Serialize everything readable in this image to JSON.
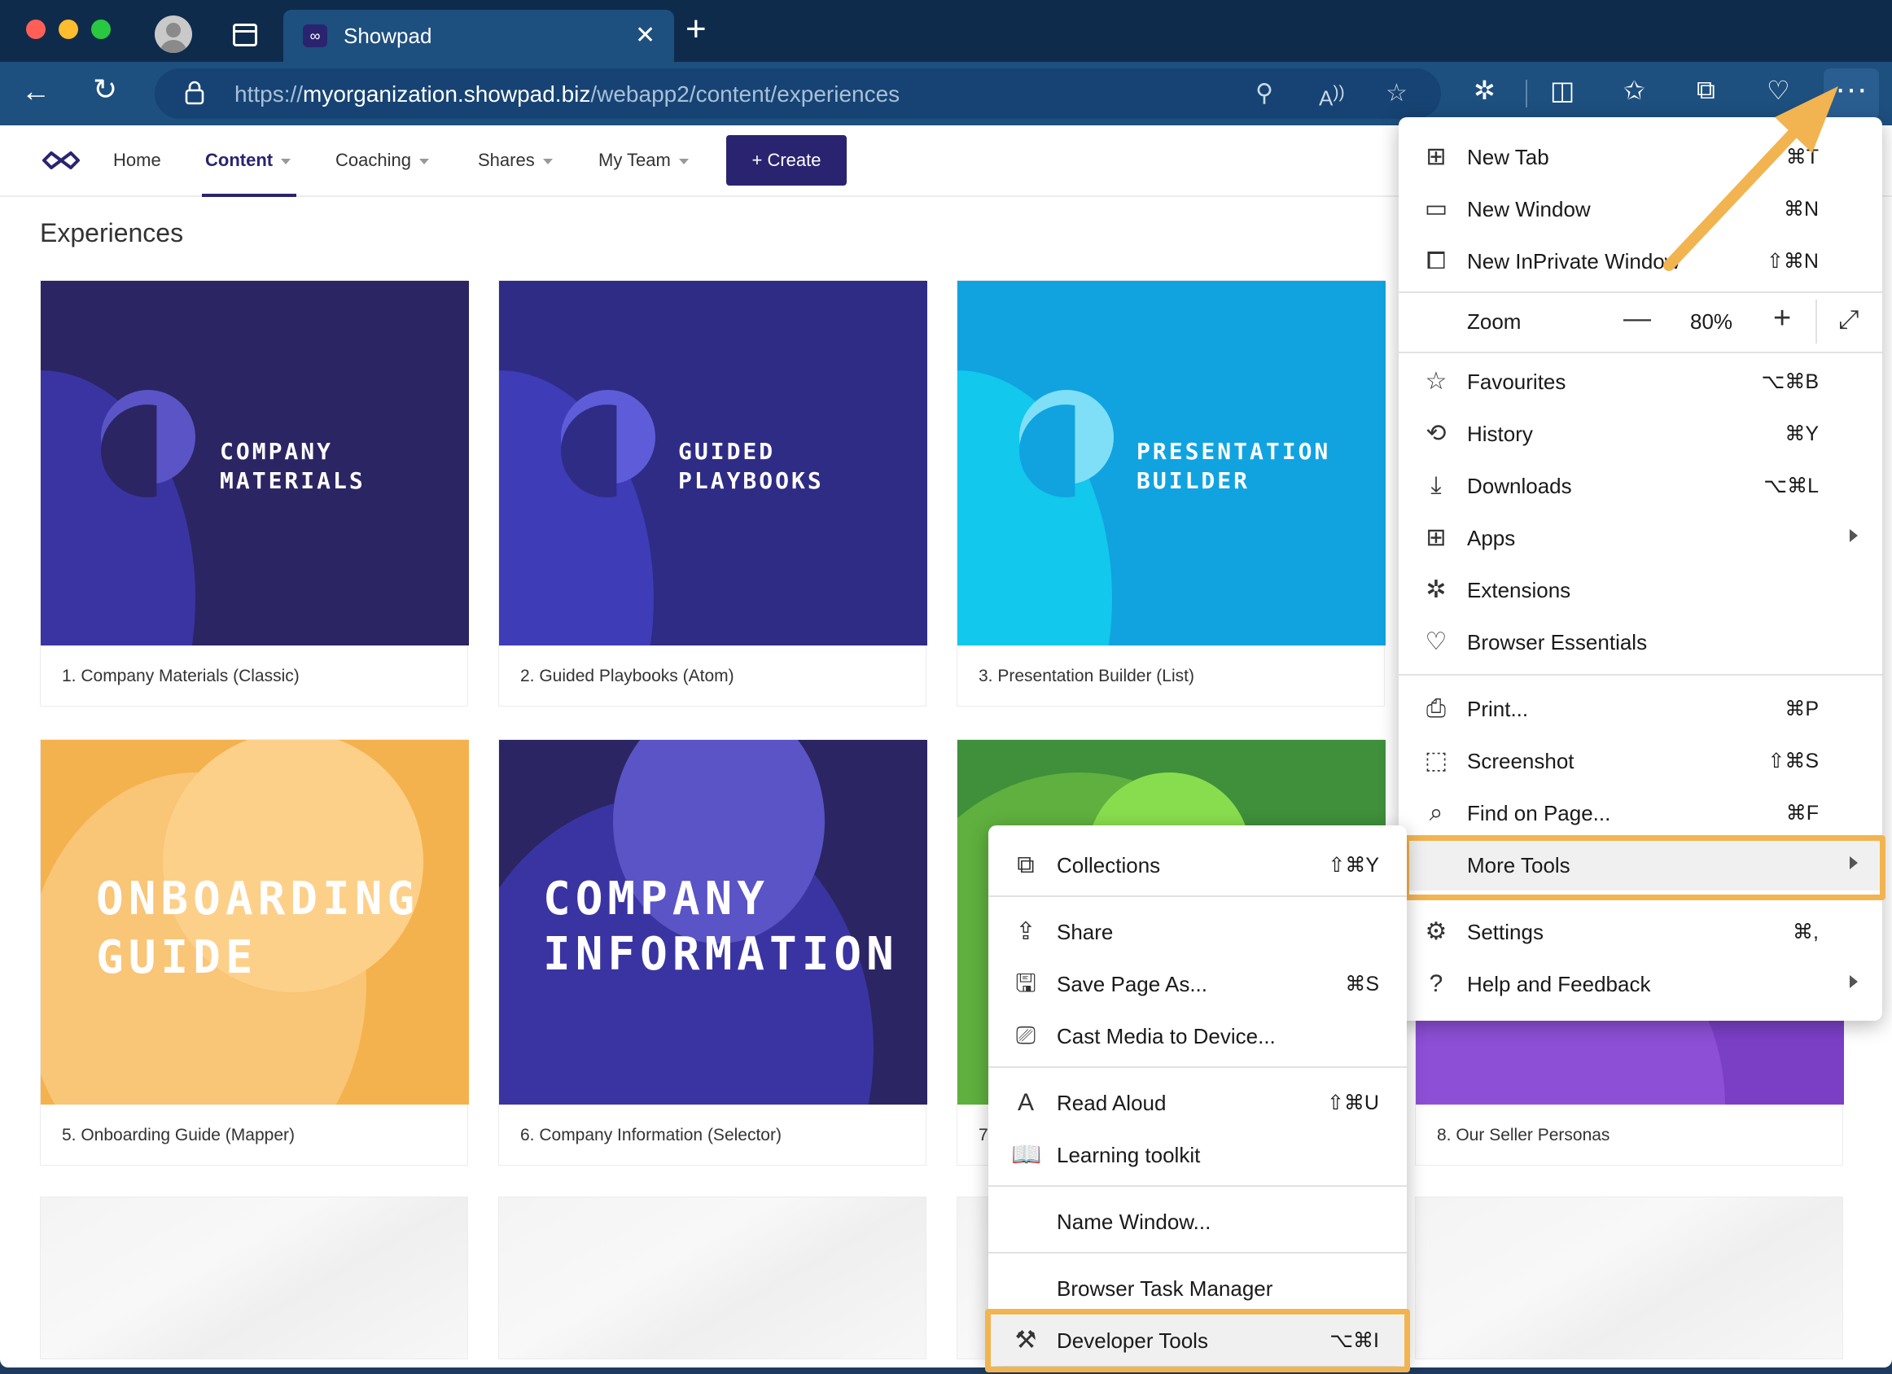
{
  "browser": {
    "tab_title": "Showpad",
    "url_scheme": "https://",
    "url_host": "myorganization.showpad.biz",
    "url_path": "/webapp2/content/experiences",
    "more_label": "···"
  },
  "app": {
    "nav": [
      {
        "label": "Home"
      },
      {
        "label": "Content"
      },
      {
        "label": "Coaching"
      },
      {
        "label": "Shares"
      },
      {
        "label": "My Team"
      }
    ],
    "create_label": "+  Create",
    "page_title": "Experiences",
    "cards": [
      {
        "thumb_title": "COMPANY\nMATERIALS",
        "label": "1. Company Materials (Classic)"
      },
      {
        "thumb_title": "GUIDED\nPLAYBOOKS",
        "label": "2. Guided Playbooks (Atom)"
      },
      {
        "thumb_title": "PRESENTATION\nBUILDER",
        "label": "3. Presentation Builder (List)"
      },
      {
        "thumb_title": "ONBOARDING\nGUIDE",
        "label": "5. Onboarding Guide (Mapper)"
      },
      {
        "thumb_title": "COMPANY\nINFORMATION",
        "label": "6. Company Information (Selector)"
      },
      {
        "thumb_title": "",
        "label": "7"
      },
      {
        "thumb_title": "",
        "label": "8. Our Seller Personas"
      }
    ]
  },
  "main_menu": {
    "items": [
      {
        "label": "New Tab",
        "shortcut": "⌘T"
      },
      {
        "label": "New Window",
        "shortcut": "⌘N"
      },
      {
        "label": "New InPrivate Window",
        "shortcut": "⇧⌘N"
      },
      {
        "label": "Zoom",
        "zoom_value": "80%"
      },
      {
        "label": "Favourites",
        "shortcut": "⌥⌘B"
      },
      {
        "label": "History",
        "shortcut": "⌘Y"
      },
      {
        "label": "Downloads",
        "shortcut": "⌥⌘L"
      },
      {
        "label": "Apps"
      },
      {
        "label": "Extensions"
      },
      {
        "label": "Browser Essentials"
      },
      {
        "label": "Print...",
        "shortcut": "⌘P"
      },
      {
        "label": "Screenshot",
        "shortcut": "⇧⌘S"
      },
      {
        "label": "Find on Page...",
        "shortcut": "⌘F"
      },
      {
        "label": "More Tools"
      },
      {
        "label": "Settings",
        "shortcut": "⌘,"
      },
      {
        "label": "Help and Feedback"
      }
    ]
  },
  "sub_menu": {
    "items": [
      {
        "label": "Collections",
        "shortcut": "⇧⌘Y"
      },
      {
        "label": "Share"
      },
      {
        "label": "Save Page As...",
        "shortcut": "⌘S"
      },
      {
        "label": "Cast Media to Device..."
      },
      {
        "label": "Read Aloud",
        "shortcut": "⇧⌘U"
      },
      {
        "label": "Learning toolkit"
      },
      {
        "label": "Name Window..."
      },
      {
        "label": "Browser Task Manager"
      },
      {
        "label": "Developer Tools",
        "shortcut": "⌥⌘I"
      }
    ]
  },
  "colors": {
    "accent_highlight": "#f2b450",
    "brand": "#2a2470",
    "browser_frame": "#1d4f7f"
  }
}
